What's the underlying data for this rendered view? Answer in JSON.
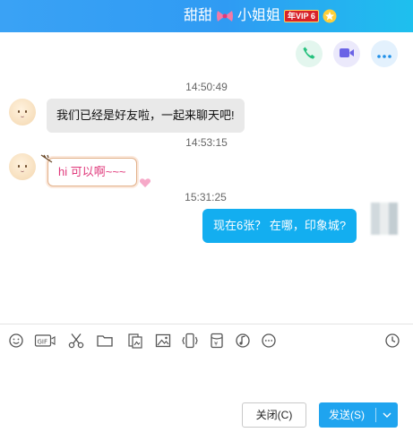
{
  "header": {
    "title_left": "甜甜",
    "title_right": "小姐姐",
    "vip_badge": "年VIP 6",
    "bow_icon": "pink-bow-icon",
    "star_icon": "vip-star-icon"
  },
  "actions": {
    "phone_icon": "phone-icon",
    "video_icon": "video-camera-icon",
    "more_icon": "more-dots-icon"
  },
  "messages": [
    {
      "time": "14:50:49",
      "sender": "other",
      "text": "我们已经是好友啦，一起来聊天吧!"
    },
    {
      "time": "14:53:15",
      "sender": "other",
      "text": "hi 可以啊~~~"
    },
    {
      "time": "15:31:25",
      "sender": "me",
      "text": "现在6张？ 在哪，印象城?"
    }
  ],
  "toolbar": [
    "emoji-icon",
    "gif-icon",
    "scissors-icon",
    "folder-icon",
    "image-gallery-icon",
    "picture-icon",
    "shake-icon",
    "red-packet-icon",
    "music-icon",
    "more-icon",
    "history-clock-icon"
  ],
  "buttons": {
    "close": "关闭(C)",
    "send": "发送(S)"
  },
  "colors": {
    "header_start": "#3aa2f5",
    "header_end": "#1ec0ee",
    "my_bubble": "#13aef0",
    "send_button": "#1fa4ef"
  }
}
